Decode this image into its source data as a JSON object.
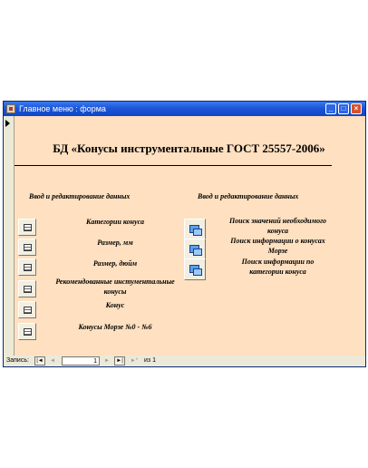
{
  "window": {
    "title": "Главное меню : форма",
    "minimize_label": "_",
    "maximize_label": "□",
    "close_label": "×"
  },
  "form": {
    "title": "БД «Конусы инструментальные ГОСТ 25557-2006»",
    "left_section_title": "Ввод и редактирование данных",
    "right_section_title": "Ввод и редактирование данных",
    "left_items": [
      "Категории конуса",
      "Размер, мм",
      "Размер, дюйм",
      "Рекомендованные инстументальные конусы",
      "Конус",
      "Конусы Морзе №0 - №6"
    ],
    "right_items": [
      "Поиск значений необходимого конуса",
      "Поиск информации о конусах Морзе",
      "Поиск информации по категории конуса"
    ]
  },
  "navigation": {
    "label": "Запись:",
    "first": "|◄",
    "prev": "◄",
    "current": "1",
    "next": "►",
    "last": "►|",
    "new": "►*",
    "of_text": "из 1"
  }
}
